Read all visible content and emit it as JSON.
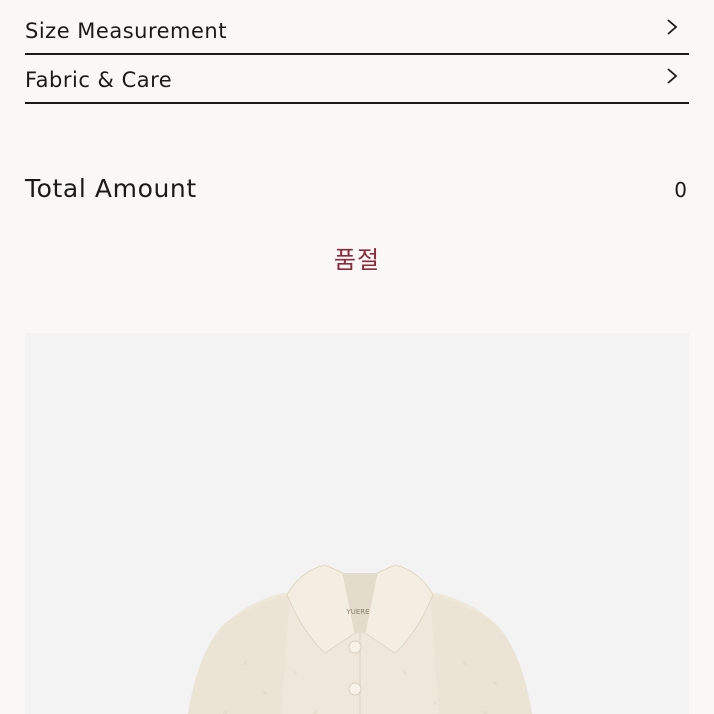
{
  "accordions": [
    {
      "label": "Size Measurement"
    },
    {
      "label": "Fabric & Care"
    }
  ],
  "total": {
    "label": "Total Amount",
    "value": "0"
  },
  "status": {
    "soldout_label": "품절",
    "color": "#8c2a3c"
  },
  "product_image": {
    "icon": "coat-photo",
    "brand_tag": "YUERE"
  }
}
